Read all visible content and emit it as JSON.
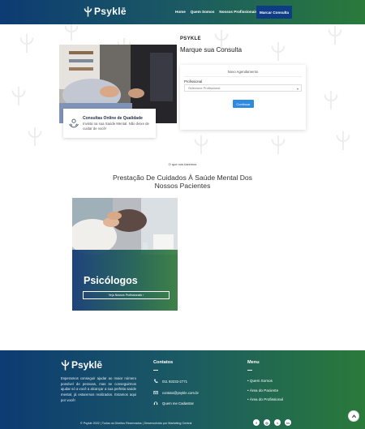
{
  "colors": {
    "gradient_start": "#0d3b73",
    "gradient_end": "#2a7a3a",
    "cta": "#0f3d84",
    "form_button": "#2d8ae0"
  },
  "header": {
    "logo_text": "Psyklē",
    "nav": [
      "Home",
      "Quem Somos",
      "Nossos Profissionais"
    ],
    "cta_label": "Marcar Consulta"
  },
  "hero": {
    "caption_title": "Consultas Online de Qualidade",
    "caption_text": "Invista na sua Saúde Mental. Não deixe de cuidar de você!"
  },
  "form": {
    "brand": "PSYKLE",
    "title": "Marque sua Consulta",
    "card_title": "Novo Agendamento",
    "professional_label": "Profissional",
    "professional_value": "Selecione Profissional",
    "submit_label": "Continuar"
  },
  "services": {
    "kicker": "O que nós fazemos",
    "title_line1": "Prestação De Cuidados À Saúde Mental Dos",
    "title_line2": "Nossos Pacientes",
    "card_name": "Psicólogos",
    "card_button": "Veja Nossos Profissionais  ›"
  },
  "footer": {
    "logo_text": "Psyklē",
    "description": "Esperamos conseguir ajudar ao maior número possível de pessoas, mas se conseguirmos ajudar só a você a alcançar a sua perfeita saúde mental, já estaremos realizados. Estamos aqui por você!",
    "contacts_heading": "Contatos",
    "phone": "011 93232-2771",
    "email": "contato@psykle.com.br",
    "link_label": "Quem me Cadastrar",
    "menu_heading": "Menu",
    "menu_items": [
      "• Quem Somos",
      "• Área do Paciente",
      "• Área do Profissional"
    ],
    "copyright": "© Psykle 2022 | Todos os Direitos Reservados | Desenvolvido por Marketing Central"
  }
}
